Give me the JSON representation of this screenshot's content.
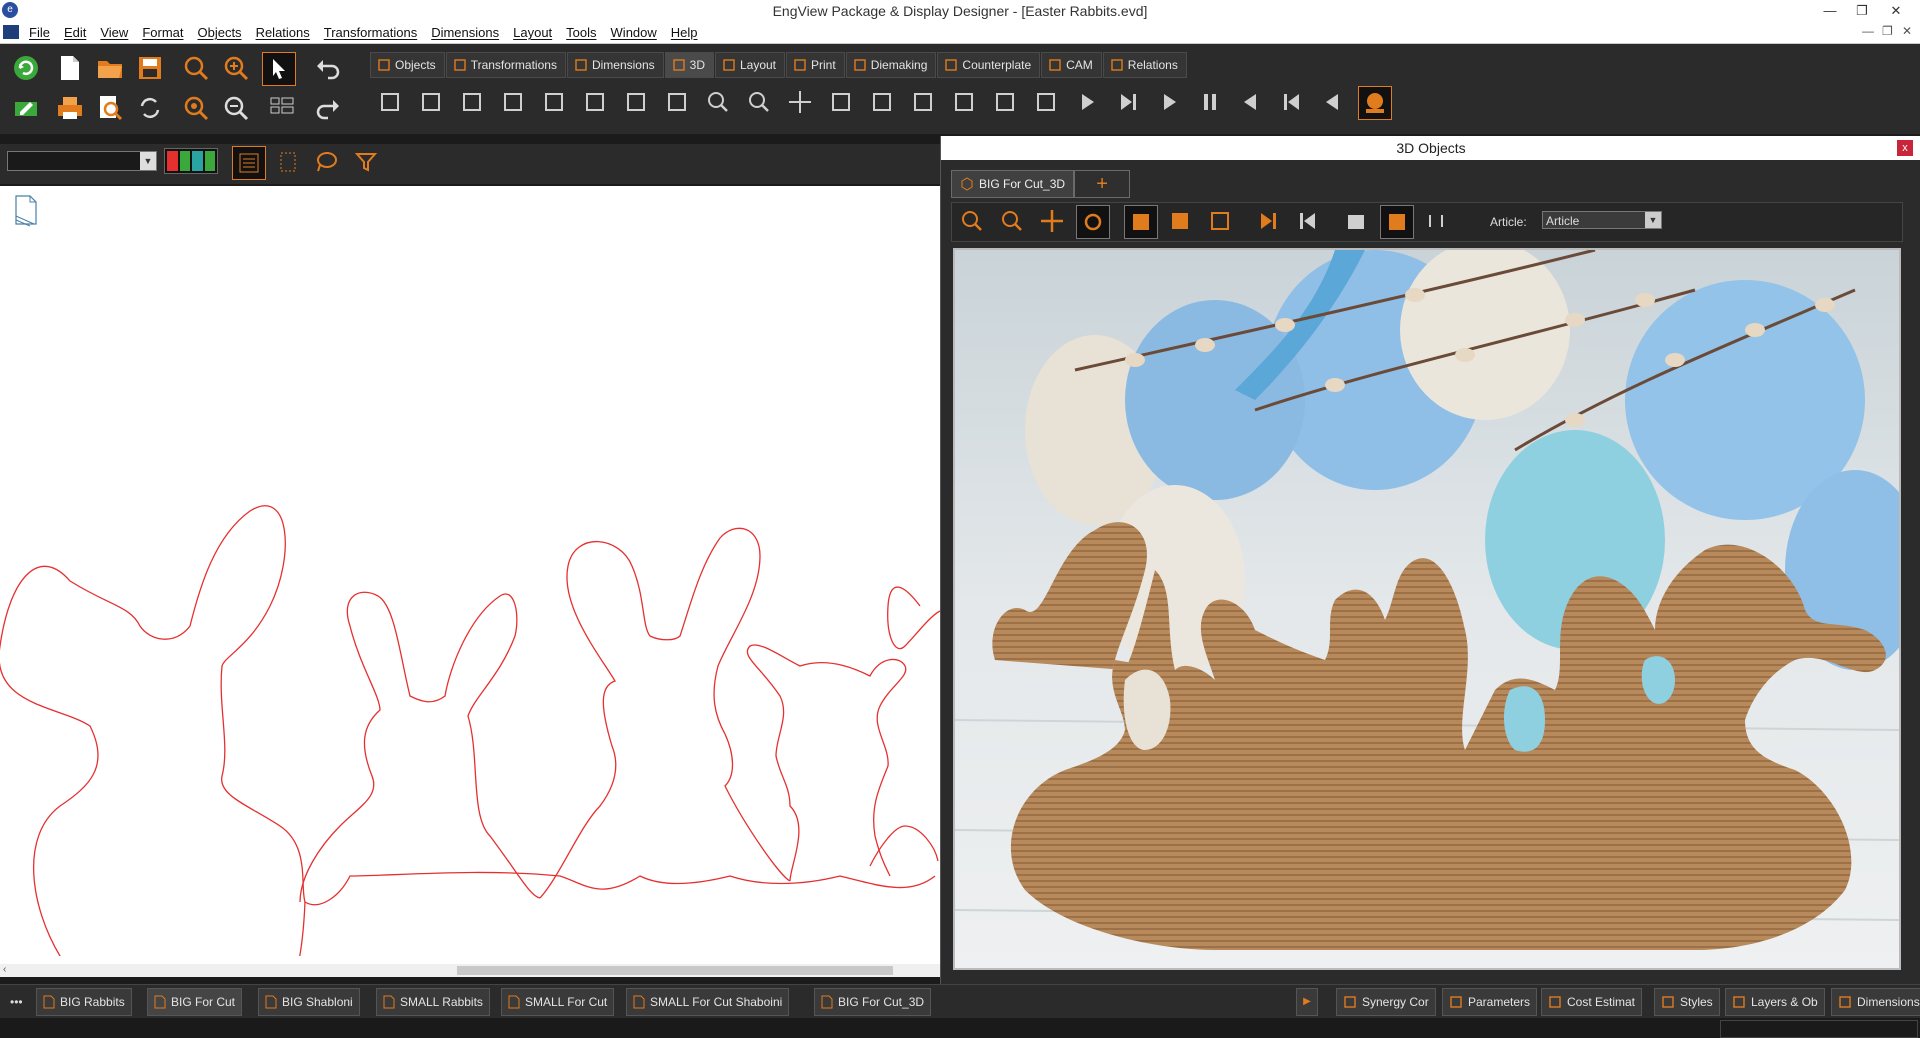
{
  "window": {
    "title": "EngView Package & Display Designer - [Easter Rabbits.evd]",
    "minimize": "—",
    "restore": "❐",
    "close": "✕"
  },
  "menu": [
    "File",
    "Edit",
    "View",
    "Format",
    "Objects",
    "Relations",
    "Transformations",
    "Dimensions",
    "Layout",
    "Tools",
    "Window",
    "Help"
  ],
  "mdi_controls": {
    "minimize": "—",
    "restore": "❐",
    "close": "✕"
  },
  "toolbar_tabs": [
    {
      "label": "Objects",
      "icon": "pin-icon"
    },
    {
      "label": "Transformations",
      "icon": "transform-icon"
    },
    {
      "label": "Dimensions",
      "icon": "dimension-icon"
    },
    {
      "label": "3D",
      "icon": "cube-icon"
    },
    {
      "label": "Layout",
      "icon": "layout-icon"
    },
    {
      "label": "Print",
      "icon": "print-icon"
    },
    {
      "label": "Diemaking",
      "icon": "diemaking-icon"
    },
    {
      "label": "Counterplate",
      "icon": "counterplate-icon"
    },
    {
      "label": "CAM",
      "icon": "cam-icon"
    },
    {
      "label": "Relations",
      "icon": "relations-icon"
    }
  ],
  "panel3d": {
    "title": "3D Objects",
    "close": "x",
    "tab_label": "BIG For Cut_3D",
    "add_tab": "+",
    "article_label": "Article:",
    "article_value": "Article"
  },
  "bottom_tabs": [
    {
      "label": "BIG Rabbits",
      "active": false
    },
    {
      "label": "BIG For Cut",
      "active": true
    },
    {
      "label": "BIG Shabloni",
      "active": false
    },
    {
      "label": "SMALL Rabbits",
      "active": false
    },
    {
      "label": "SMALL For Cut",
      "active": false
    },
    {
      "label": "SMALL For Cut Shaboini",
      "active": false
    },
    {
      "label": "BIG For Cut_3D",
      "active": false
    }
  ],
  "bottom_more": "•••",
  "right_tabs": [
    {
      "label": "Synergy Cor",
      "icon": "synergy-icon"
    },
    {
      "label": "Parameters",
      "icon": "parameters-icon"
    },
    {
      "label": "Cost Estimat",
      "icon": "cost-icon"
    },
    {
      "label": "Styles",
      "icon": "styles-icon"
    },
    {
      "label": "Layers & Ob",
      "icon": "layers-icon"
    },
    {
      "label": "Dimensions",
      "icon": "dimension-icon"
    }
  ],
  "colors": {
    "accent": "#e07b1e",
    "cut_line": "#e53030",
    "cardboard": "#b8895a"
  }
}
